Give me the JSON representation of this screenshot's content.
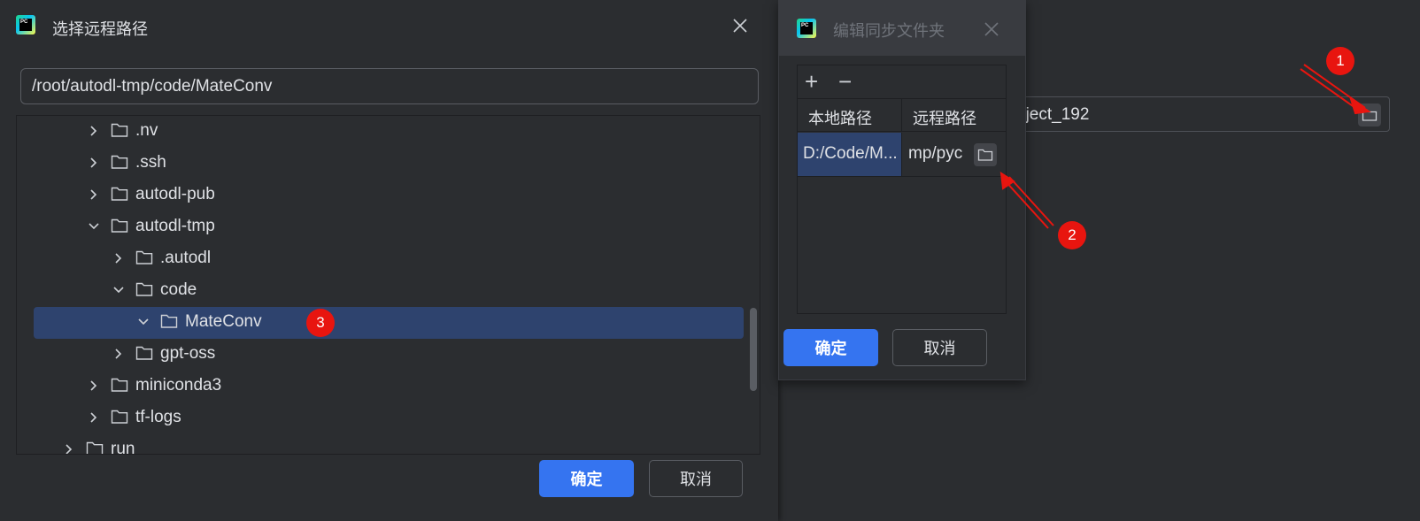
{
  "background": {
    "path_text": "oject_192"
  },
  "remote_dialog": {
    "title": "选择远程路径",
    "path_value": "/root/autodl-tmp/code/MateConv",
    "tree": [
      {
        "label": ".nv",
        "expanded": false,
        "depth": 2,
        "selected": false
      },
      {
        "label": ".ssh",
        "expanded": false,
        "depth": 2,
        "selected": false
      },
      {
        "label": "autodl-pub",
        "expanded": false,
        "depth": 2,
        "selected": false
      },
      {
        "label": "autodl-tmp",
        "expanded": true,
        "depth": 2,
        "selected": false
      },
      {
        "label": ".autodl",
        "expanded": false,
        "depth": 3,
        "selected": false
      },
      {
        "label": "code",
        "expanded": true,
        "depth": 3,
        "selected": false
      },
      {
        "label": "MateConv",
        "expanded": true,
        "depth": 4,
        "selected": true
      },
      {
        "label": "gpt-oss",
        "expanded": false,
        "depth": 3,
        "selected": false
      },
      {
        "label": "miniconda3",
        "expanded": false,
        "depth": 2,
        "selected": false
      },
      {
        "label": "tf-logs",
        "expanded": false,
        "depth": 2,
        "selected": false
      },
      {
        "label": "run",
        "expanded": false,
        "depth": 1,
        "selected": false
      }
    ],
    "ok_label": "确定",
    "cancel_label": "取消"
  },
  "sync_dialog": {
    "title": "编辑同步文件夹",
    "add_glyph": "+",
    "remove_glyph": "−",
    "col_local": "本地路径",
    "col_remote": "远程路径",
    "row_local": "D:/Code/M...",
    "row_remote": "mp/pyc",
    "ok_label": "确定",
    "cancel_label": "取消"
  },
  "annotations": {
    "badge_1": "1",
    "badge_2": "2",
    "badge_3": "3",
    "color": "#e8150f"
  },
  "colors": {
    "accent": "#3574f0",
    "selection": "#2e436e",
    "background": "#2b2d30"
  }
}
